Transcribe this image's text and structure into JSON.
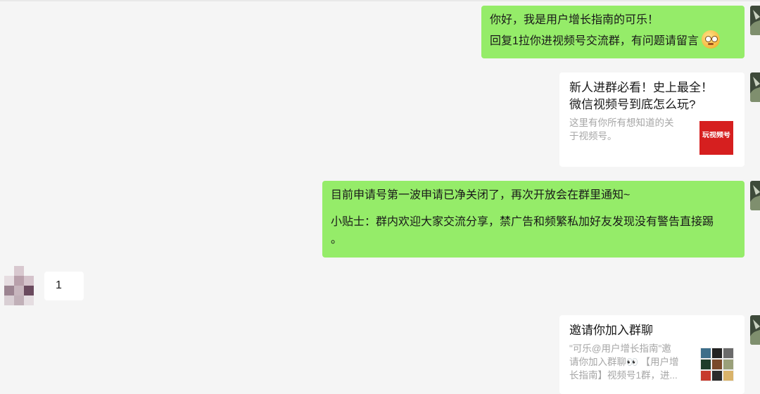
{
  "messages": [
    {
      "type": "text",
      "sender": "me",
      "lines": [
        "你好，我是用户增长指南的可乐！",
        "回复1拉你进视频号交流群，有问题请留言"
      ],
      "trailing_icon": "smiling-glasses-emoji-icon"
    },
    {
      "type": "card",
      "sender": "me",
      "title_lines": [
        "新人进群必看！史上最全！",
        "微信视频号到底怎么玩?"
      ],
      "desc_lines": [
        "这里有你所有想知道的关",
        "于视频号。"
      ],
      "thumb_text": "玩视频号",
      "thumb_icon": "article-thumbnail-icon"
    },
    {
      "type": "text",
      "sender": "me",
      "lines": [
        "目前申请号第一波申请已净关闭了，再次开放会在群里通知~",
        "",
        "小贴士：群内欢迎大家交流分享，禁广告和频繁私加好友发现没有警告直接踢",
        "。"
      ]
    },
    {
      "type": "text",
      "sender": "other",
      "lines": [
        "1"
      ]
    },
    {
      "type": "card",
      "sender": "me",
      "title_lines": [
        "邀请你加入群聊"
      ],
      "desc_lines": [
        "\"可乐@用户增长指南\"邀",
        "请你加入群聊👀 【用户增",
        "长指南】视频号1群，进..."
      ],
      "thumb_icon": "group-avatar-grid-icon"
    }
  ],
  "colors": {
    "background": "#f5f5f5",
    "my_bubble": "#95ec69",
    "other_bubble": "#ffffff",
    "card_desc": "#a6a6a6",
    "thumb_red": "#d61f1f"
  }
}
